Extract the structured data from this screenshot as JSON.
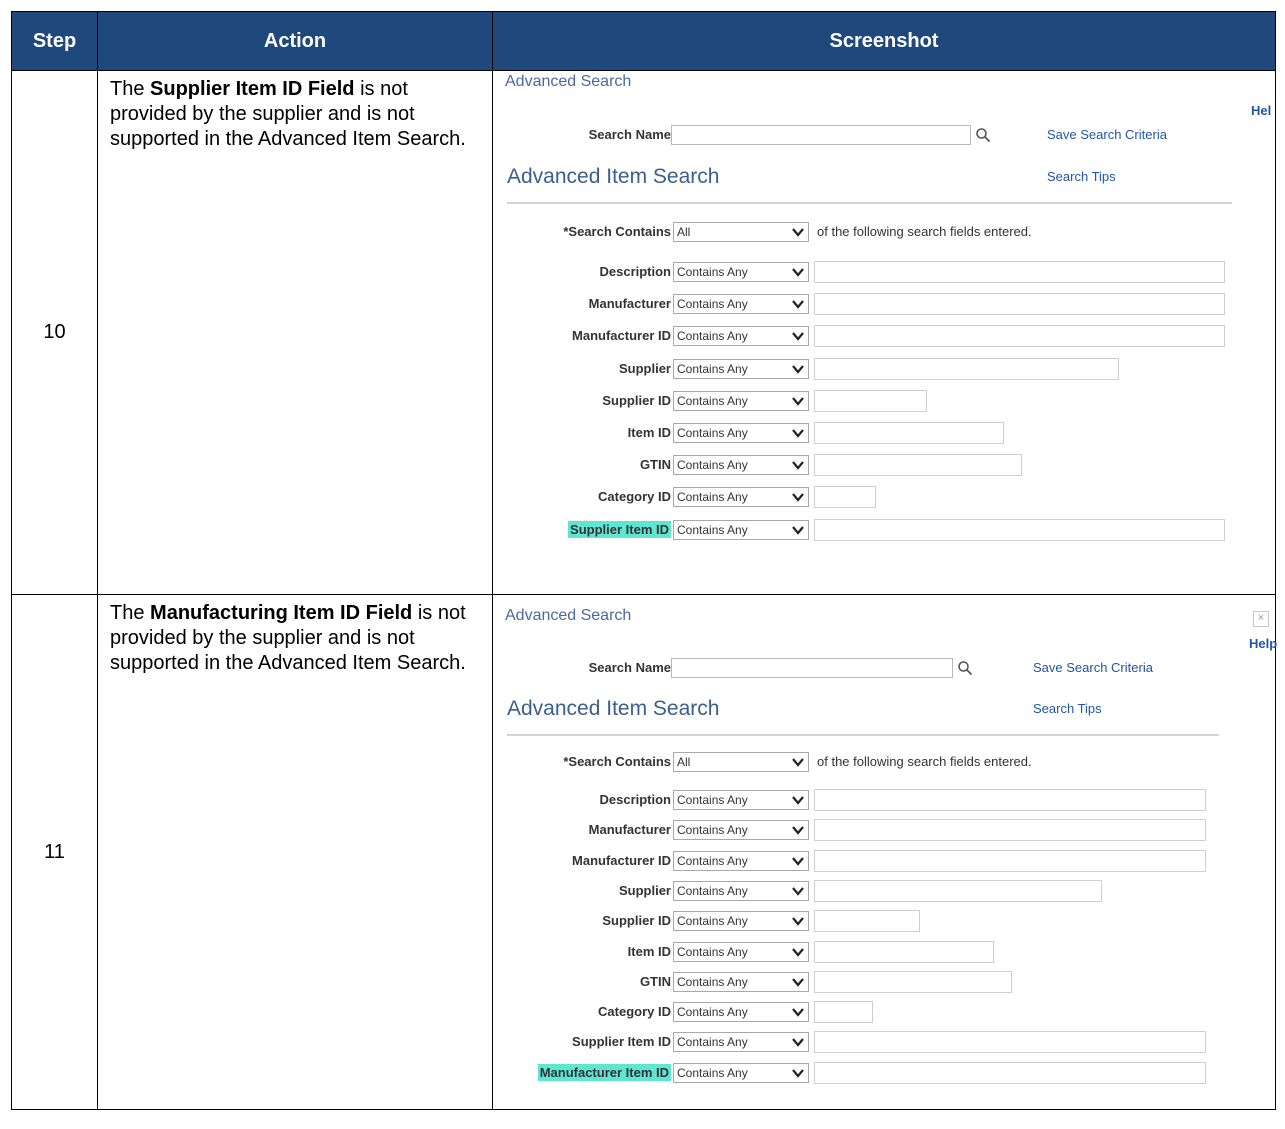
{
  "table": {
    "headers": {
      "step": "Step",
      "action": "Action",
      "screenshot": "Screenshot"
    }
  },
  "rows": [
    {
      "step": "10",
      "action_pre": "The ",
      "action_bold": "Supplier Item ID Field",
      "action_post": " is not provided by the supplier and is not supported in the Advanced Item Search.",
      "screen": {
        "title": "Advanced Search",
        "help": "Hel",
        "search_name_label": "Search Name",
        "save_link": "Save Search Criteria",
        "tips_link": "Search Tips",
        "heading": "Advanced Item Search",
        "contains_label": "*Search Contains",
        "contains_value": "All",
        "contains_suffix": "of the following search fields entered.",
        "operator": "Contains Any",
        "fields": [
          {
            "label": "Description"
          },
          {
            "label": "Manufacturer"
          },
          {
            "label": "Manufacturer ID"
          },
          {
            "label": "Supplier"
          },
          {
            "label": "Supplier ID"
          },
          {
            "label": "Item ID"
          },
          {
            "label": "GTIN"
          },
          {
            "label": "Category ID"
          },
          {
            "label": "Supplier Item ID"
          }
        ]
      }
    },
    {
      "step": "11",
      "action_pre": "The ",
      "action_bold": "Manufacturing Item ID Field",
      "action_post": " is not provided by the supplier and is not supported in the Advanced Item Search.",
      "screen": {
        "title": "Advanced Search",
        "close": "×",
        "help": "Help",
        "search_name_label": "Search Name",
        "save_link": "Save Search Criteria",
        "tips_link": "Search Tips",
        "heading": "Advanced Item Search",
        "contains_label": "*Search Contains",
        "contains_value": "All",
        "contains_suffix": "of the following search fields entered.",
        "operator": "Contains Any",
        "fields": [
          {
            "label": "Description"
          },
          {
            "label": "Manufacturer"
          },
          {
            "label": "Manufacturer ID"
          },
          {
            "label": "Supplier"
          },
          {
            "label": "Supplier ID"
          },
          {
            "label": "Item ID"
          },
          {
            "label": "GTIN"
          },
          {
            "label": "Category ID"
          },
          {
            "label": "Supplier Item ID"
          },
          {
            "label": "Manufacturer Item ID"
          }
        ]
      }
    }
  ],
  "highlight_color": "#5ee6d2",
  "header_color": "#1f497d"
}
